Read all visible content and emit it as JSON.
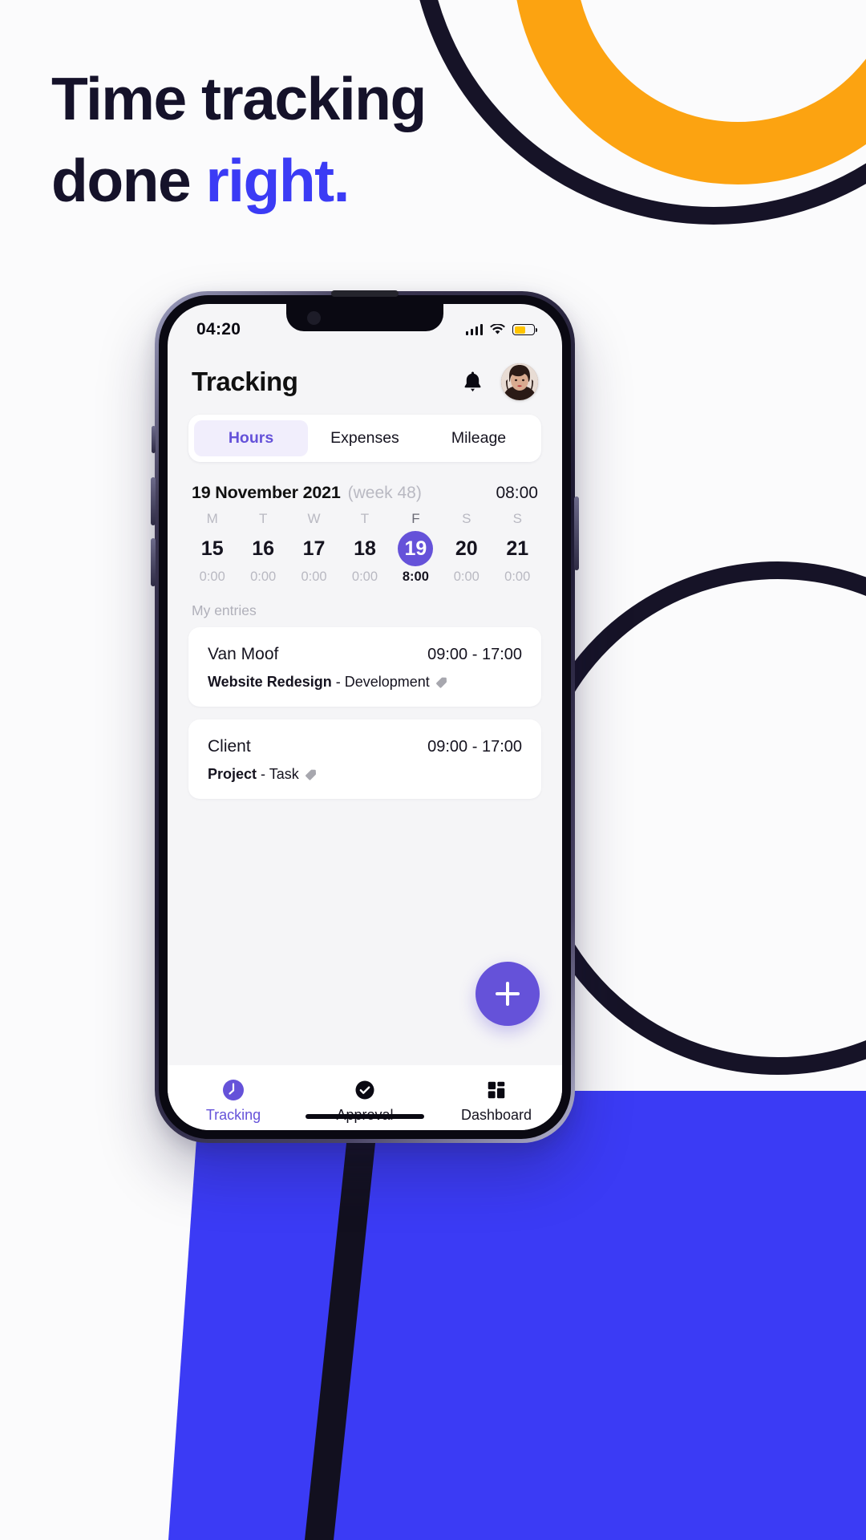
{
  "marketing": {
    "headline_line1": "Time tracking",
    "headline_line2_plain": "done ",
    "headline_line2_accent": "right."
  },
  "colors": {
    "accent_purple": "#6552D9",
    "brand_blue": "#3B3BF5",
    "dark_navy": "#161327",
    "orange": "#FCA311",
    "battery_yellow": "#FFC400"
  },
  "status_bar": {
    "time": "04:20",
    "signal_icon": "cellular-bars-icon",
    "wifi_icon": "wifi-icon",
    "battery_icon": "battery-low-power-icon"
  },
  "app": {
    "header": {
      "title": "Tracking",
      "bell_icon": "bell-icon",
      "avatar": "user-avatar"
    },
    "tabs": [
      {
        "label": "Hours",
        "active": true
      },
      {
        "label": "Expenses",
        "active": false
      },
      {
        "label": "Mileage",
        "active": false
      }
    ],
    "date_bar": {
      "date": "19 November 2021",
      "week": "(week 48)",
      "total": "08:00"
    },
    "week_days": [
      {
        "letter": "M",
        "number": "15",
        "hours": "0:00",
        "selected": false
      },
      {
        "letter": "T",
        "number": "16",
        "hours": "0:00",
        "selected": false
      },
      {
        "letter": "W",
        "number": "17",
        "hours": "0:00",
        "selected": false
      },
      {
        "letter": "T",
        "number": "18",
        "hours": "0:00",
        "selected": false
      },
      {
        "letter": "F",
        "number": "19",
        "hours": "8:00",
        "selected": true
      },
      {
        "letter": "S",
        "number": "20",
        "hours": "0:00",
        "selected": false
      },
      {
        "letter": "S",
        "number": "21",
        "hours": "0:00",
        "selected": false
      }
    ],
    "entries_label": "My entries",
    "entries": [
      {
        "client": "Van Moof",
        "time": "09:00 - 17:00",
        "project": "Website Redesign",
        "separator": " - ",
        "task": "Development",
        "tag_icon": "tag-icon"
      },
      {
        "client": "Client",
        "time": "09:00 - 17:00",
        "project": "Project",
        "separator": " - ",
        "task": "Task",
        "tag_icon": "tag-icon"
      }
    ],
    "fab": {
      "icon": "plus-icon"
    },
    "bottom_nav": [
      {
        "label": "Tracking",
        "icon": "clock-icon",
        "active": true
      },
      {
        "label": "Approval",
        "icon": "check-circle-icon",
        "active": false
      },
      {
        "label": "Dashboard",
        "icon": "grid-icon",
        "active": false
      }
    ]
  }
}
